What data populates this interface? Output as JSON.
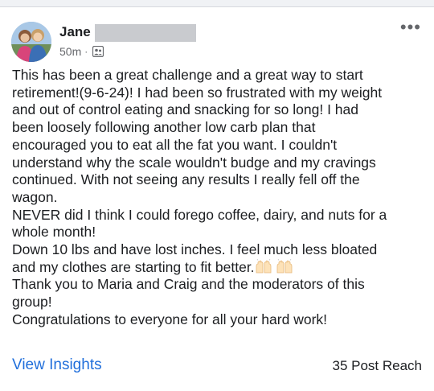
{
  "post": {
    "author_name": "Jane",
    "timestamp": "50m",
    "separator": "·",
    "body_lines": [
      "This has been a great challenge and a great way to start",
      "retirement!(9-6-24)! I had been so frustrated with my weight",
      "and out of control eating and snacking for so long! I had",
      "been loosely following another low carb plan that",
      "encouraged you to eat all the fat you want. I couldn't",
      "understand why the scale wouldn't budge and my cravings",
      "continued. With not seeing any results I really fell off the",
      "wagon.",
      "NEVER did I think I could forego coffee, dairy, and nuts for a",
      "whole month!",
      "Down 10 lbs and have lost inches. I feel much less bloated",
      "and my clothes are starting to fit better.",
      "Thank you to Maria and Craig and the moderators of this",
      "group!",
      "Congratulations to everyone for all your hard work!"
    ]
  },
  "footer": {
    "view_insights": "View Insights",
    "post_reach": "35 Post Reach"
  },
  "icons": {
    "more": "more-options-icon",
    "group": "group-icon",
    "emoji": "raising-hands-emoji"
  },
  "colors": {
    "link": "#216fdb",
    "meta": "#65676b",
    "text": "#1c1e21"
  }
}
